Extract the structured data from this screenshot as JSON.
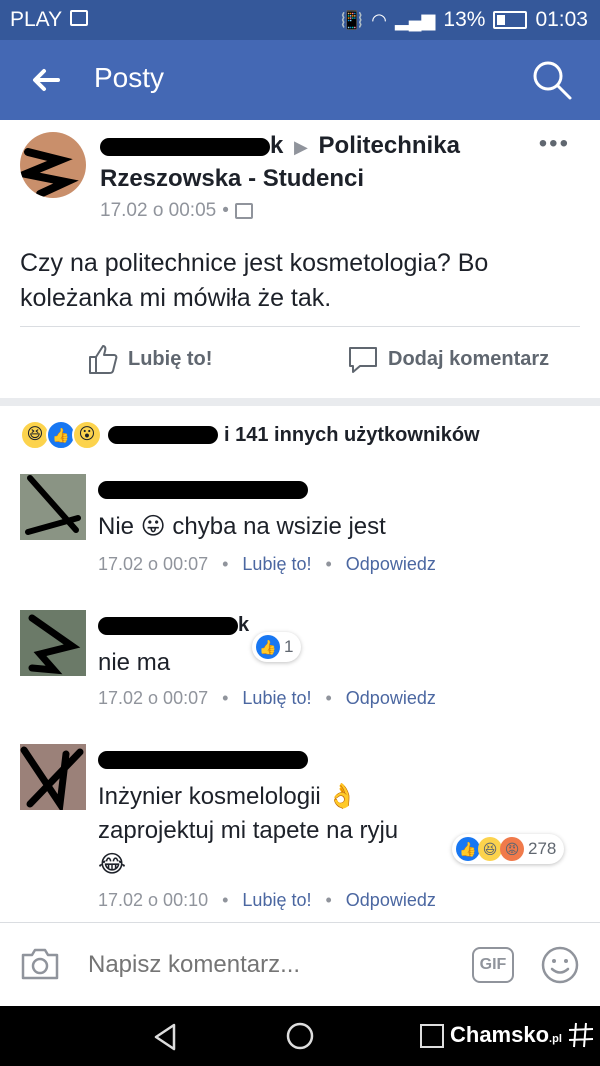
{
  "status_bar": {
    "carrier": "PLAY",
    "battery": "13%",
    "time": "01:03"
  },
  "header": {
    "title": "Posty"
  },
  "post": {
    "author_suffix": "k",
    "group": "Politechnika Rzeszowska - Studenci",
    "timestamp": "17.02 o 00:05",
    "text": "Czy na politechnice jest kosmetologia? Bo koleżanka mi mówiła że tak.",
    "like_label": "Lubię to!",
    "comment_label": "Dodaj komentarz"
  },
  "reactions": {
    "summary": "i 141 innych użytkowników"
  },
  "comments": [
    {
      "text": "Nie 😛 chyba na wsizie jest",
      "time": "17.02 o 00:07",
      "like": "Lubię to!",
      "reply": "Odpowiedz"
    },
    {
      "name_suffix": "k",
      "text": "nie ma",
      "time": "17.02 o 00:07",
      "like": "Lubię to!",
      "reply": "Odpowiedz",
      "reaction_count": "1"
    },
    {
      "text_line1": "Inżynier kosmelologii 👌",
      "text_line2": "zaprojektuj mi tapete na ryju",
      "text_line3": "😂",
      "time": "17.02 o 00:10",
      "like": "Lubię to!",
      "reply": "Odpowiedz",
      "reaction_count": "278"
    }
  ],
  "composer": {
    "placeholder": "Napisz komentarz...",
    "gif_label": "GIF"
  },
  "watermark": {
    "brand": "Chamsko",
    "tld": ".pl"
  },
  "icons": [
    "back-arrow-icon",
    "search-icon",
    "more-icon",
    "group-icon",
    "like-icon",
    "comment-icon",
    "camera-icon",
    "gif-icon",
    "smiley-icon"
  ],
  "colors": {
    "header": "#4468b4",
    "status_bar": "#35589a",
    "link": "#4b67a1",
    "like_blue": "#1877f2"
  }
}
